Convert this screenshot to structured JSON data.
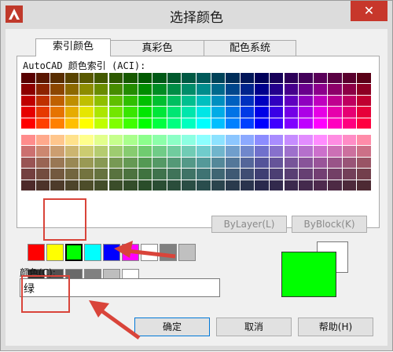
{
  "window": {
    "title": "选择颜色",
    "close_glyph": "✕"
  },
  "tabs": [
    {
      "label": "索引颜色",
      "active": true
    },
    {
      "label": "真彩色",
      "active": false
    },
    {
      "label": "配色系统",
      "active": false
    }
  ],
  "aci_label": "AutoCAD 颜色索引 (ACI):",
  "standard_colors": {
    "row1": [
      "#ff0000",
      "#ffff00",
      "#00ff00",
      "#00ffff",
      "#0000ff",
      "#ff00ff",
      "#ffffff",
      "#808080",
      "#c0c0c0"
    ],
    "row2": [
      "#333333",
      "#505050",
      "#696969",
      "#808080",
      "#bebebe",
      "#ffffff"
    ],
    "selected": "#00ff00"
  },
  "buttons": {
    "bylayer": "ByLayer(L)",
    "byblock": "ByBlock(K)",
    "ok": "确定",
    "cancel": "取消",
    "help": "帮助(H)"
  },
  "color_field": {
    "label": "颜色(C):",
    "value": "绿"
  },
  "preview": {
    "new_color": "#00ff00",
    "old_color": "#ffffff"
  },
  "accent_colors": {
    "annotation": "#d9443a",
    "titlebar_close": "#c7372b",
    "logo": "#c0392b"
  },
  "icons": [
    "autocad-logo-icon",
    "close-icon",
    "arrow-pointer-icon"
  ]
}
